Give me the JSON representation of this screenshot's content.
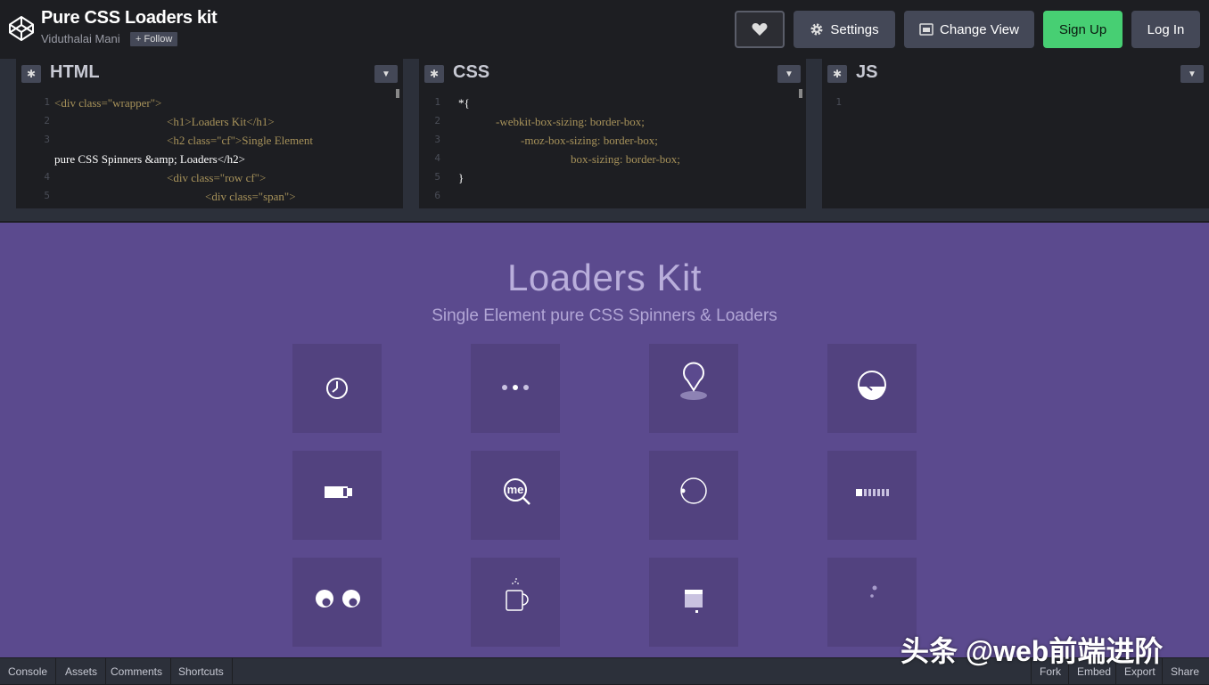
{
  "header": {
    "title": "Pure CSS Loaders kit",
    "author": "Viduthalai Mani",
    "follow_label": "+ Follow",
    "buttons": {
      "settings": "Settings",
      "change_view": "Change View",
      "sign_up": "Sign Up",
      "log_in": "Log In"
    }
  },
  "editors": {
    "html": {
      "title": "HTML",
      "line_numbers": [
        "1",
        "2",
        "3",
        "",
        "4",
        "5"
      ],
      "lines": [
        "<div class=\"wrapper\">",
        "<h1>Loaders Kit</h1>",
        "<h2 class=\"cf\">Single Element",
        "pure CSS Spinners &amp; Loaders</h2>",
        "<div class=\"row cf\">",
        "<div class=\"span\">"
      ]
    },
    "css": {
      "title": "CSS",
      "line_numbers": [
        "1",
        "2",
        "3",
        "4",
        "5",
        "6"
      ],
      "lines": [
        "*{",
        "-webkit-box-sizing: border-box;",
        "-moz-box-sizing: border-box;",
        "box-sizing: border-box;",
        "}",
        ""
      ]
    },
    "js": {
      "title": "JS",
      "line_numbers": [
        "1"
      ],
      "lines": [
        ""
      ]
    }
  },
  "preview": {
    "title": "Loaders Kit",
    "subtitle": "Single Element pure CSS Spinners & Loaders",
    "loaders": [
      {
        "icon": "clock-loader-icon"
      },
      {
        "icon": "dots-loader-icon"
      },
      {
        "icon": "map-pin-loader-icon"
      },
      {
        "icon": "half-circle-loader-icon"
      },
      {
        "icon": "battery-loader-icon"
      },
      {
        "icon": "magnifier-loader-icon",
        "text": "me"
      },
      {
        "icon": "orbit-loader-icon"
      },
      {
        "icon": "progress-bars-loader-icon"
      },
      {
        "icon": "eyes-loader-icon"
      },
      {
        "icon": "coffee-cup-loader-icon"
      },
      {
        "icon": "window-loader-icon"
      },
      {
        "icon": "spinner-dots-loader-icon"
      }
    ]
  },
  "footer": {
    "left": [
      "Console",
      "Assets",
      "Comments",
      "Shortcuts"
    ],
    "right": [
      "Fork",
      "Embed",
      "Export",
      "Share"
    ]
  },
  "watermark": "头条 @web前端进阶",
  "colors": {
    "preview_bg": "#5b4a8e",
    "tile_bg": "#52427f",
    "signup": "#47cf73",
    "editor_bg": "#1d1e22"
  }
}
